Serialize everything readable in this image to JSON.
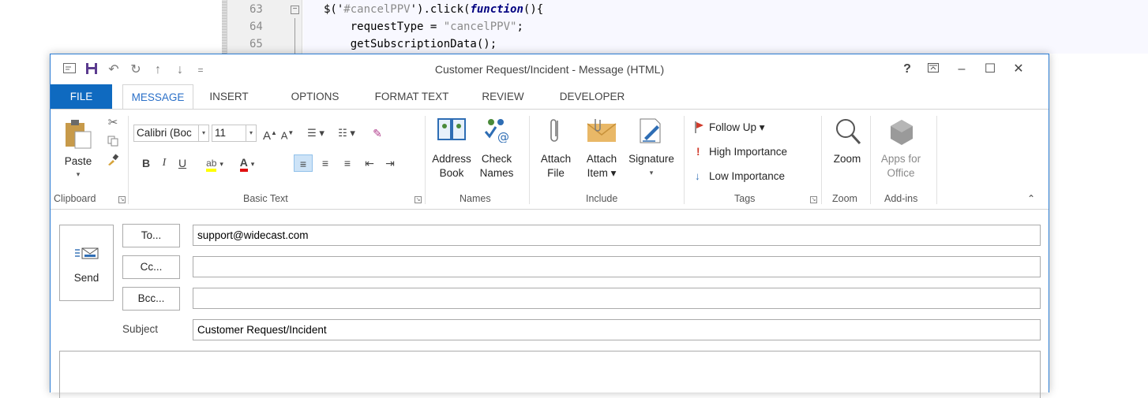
{
  "editor": {
    "lines": [
      {
        "num": "63",
        "fold": "⊟",
        "code_pre": "$('",
        "code_str": "#cancelPPV",
        "code_mid": "').click(",
        "code_kw": "function",
        "code_post": "(){"
      },
      {
        "num": "64",
        "code_pre": "    requestType = ",
        "code_str": "\"cancelPPV\"",
        "code_post": ";"
      },
      {
        "num": "65",
        "code_pre": "    getSubscriptionData();"
      }
    ]
  },
  "window": {
    "title": "Customer Request/Incident - Message (HTML)",
    "help": "?",
    "ribbon_display": "⌅",
    "minimize": "–",
    "maximize": "☐",
    "close": "✕"
  },
  "qat": {
    "save": "💾",
    "undo": "↶",
    "redo": "↻",
    "up": "↑",
    "down": "↓",
    "customize": "⩧"
  },
  "tabs": [
    "FILE",
    "MESSAGE",
    "INSERT",
    "OPTIONS",
    "FORMAT TEXT",
    "REVIEW",
    "DEVELOPER"
  ],
  "ribbon": {
    "clipboard": {
      "paste": "Paste",
      "label": "Clipboard"
    },
    "basic_text": {
      "font_name": "Calibri (Boc",
      "font_size": "11",
      "bold": "B",
      "italic": "I",
      "underline": "U",
      "grow": "A",
      "shrink": "A",
      "label": "Basic Text"
    },
    "names": {
      "address_book_1": "Address",
      "address_book_2": "Book",
      "check_names_1": "Check",
      "check_names_2": "Names",
      "label": "Names"
    },
    "include": {
      "attach_file_1": "Attach",
      "attach_file_2": "File",
      "attach_item_1": "Attach",
      "attach_item_2": "Item ▾",
      "signature_1": "Signature",
      "signature_2": "▾",
      "label": "Include"
    },
    "tags": {
      "follow_up": "Follow Up ▾",
      "high": "High Importance",
      "low": "Low Importance",
      "label": "Tags"
    },
    "zoom": {
      "zoom": "Zoom",
      "label": "Zoom"
    },
    "addins": {
      "apps_1": "Apps for",
      "apps_2": "Office",
      "label": "Add-ins"
    }
  },
  "compose": {
    "send": "Send",
    "to_button": "To...",
    "cc_button": "Cc...",
    "bcc_button": "Bcc...",
    "to_value": "support@widecast.com",
    "cc_value": "",
    "bcc_value": "",
    "subject_label": "Subject",
    "subject_value": "Customer Request/Incident"
  },
  "colors": {
    "accent": "#0f6ac0",
    "tab_active_text": "#2b70c8",
    "flag": "#d03a2a",
    "highlight": "#ffff00",
    "font_color": "#e01010"
  }
}
